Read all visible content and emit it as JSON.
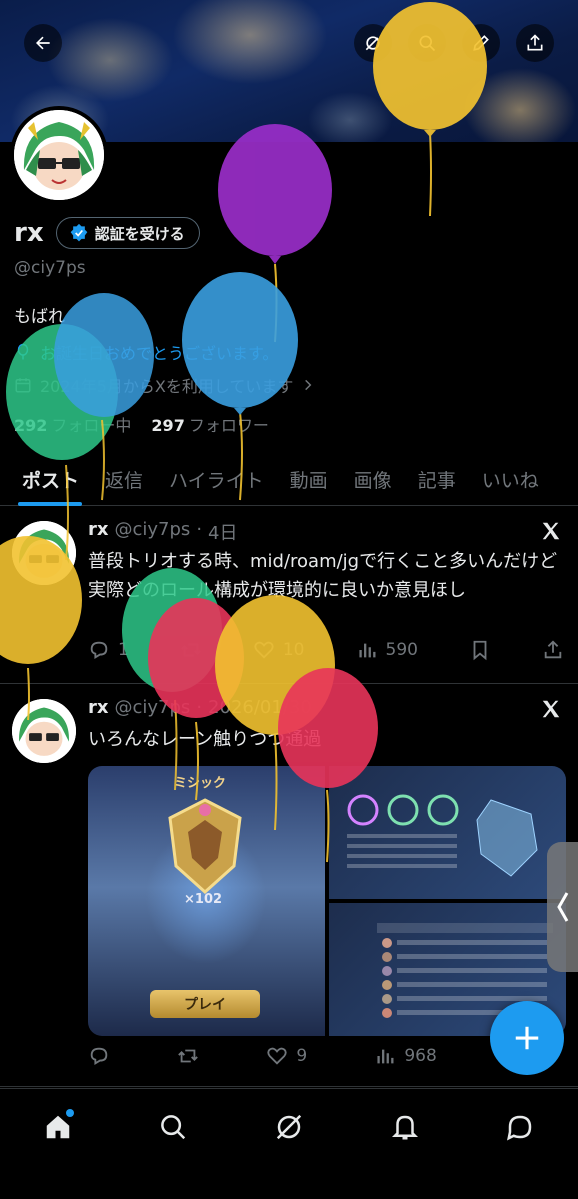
{
  "profile": {
    "name": "rx",
    "verify_label": "認証を受ける",
    "handle": "@ciy7ps",
    "bio": "もばれ",
    "birthday": "お誕生日おめでとうございます。",
    "joined": "2024年5月からXを利用しています",
    "following_count": "292",
    "following_label": "フォロー中",
    "followers_count": "297",
    "followers_label": "フォロワー"
  },
  "tabs": [
    "ポスト",
    "返信",
    "ハイライト",
    "動画",
    "画像",
    "記事",
    "いいね"
  ],
  "posts": [
    {
      "name": "rx",
      "handle": "@ciy7ps",
      "sep": "·",
      "time": "4日",
      "text": "普段トリオする時、mid/roam/jgで行くこと多いんだけど実際どのロール構成が環境的に良いか意見ほし",
      "replies": "1",
      "likes": "10",
      "views": "590"
    },
    {
      "name": "rx",
      "handle": "@ciy7ps",
      "sep": "·",
      "time": "2026/01/30",
      "text": "いろんなレーン触りつつ通過",
      "replies": "",
      "likes": "9",
      "views": "968"
    }
  ],
  "media": {
    "rank_label": "ミシック",
    "star_count": "×102",
    "play_label": "プレイ"
  },
  "colors": {
    "accent": "#1d9bf0",
    "muted": "#71767b",
    "text": "#e7e9ea",
    "balloon_yellow": "#f2c230",
    "balloon_purple": "#9a2ec9",
    "balloon_blue": "#3a9fe0",
    "balloon_green": "#2ec88a",
    "balloon_red": "#e8345a"
  }
}
